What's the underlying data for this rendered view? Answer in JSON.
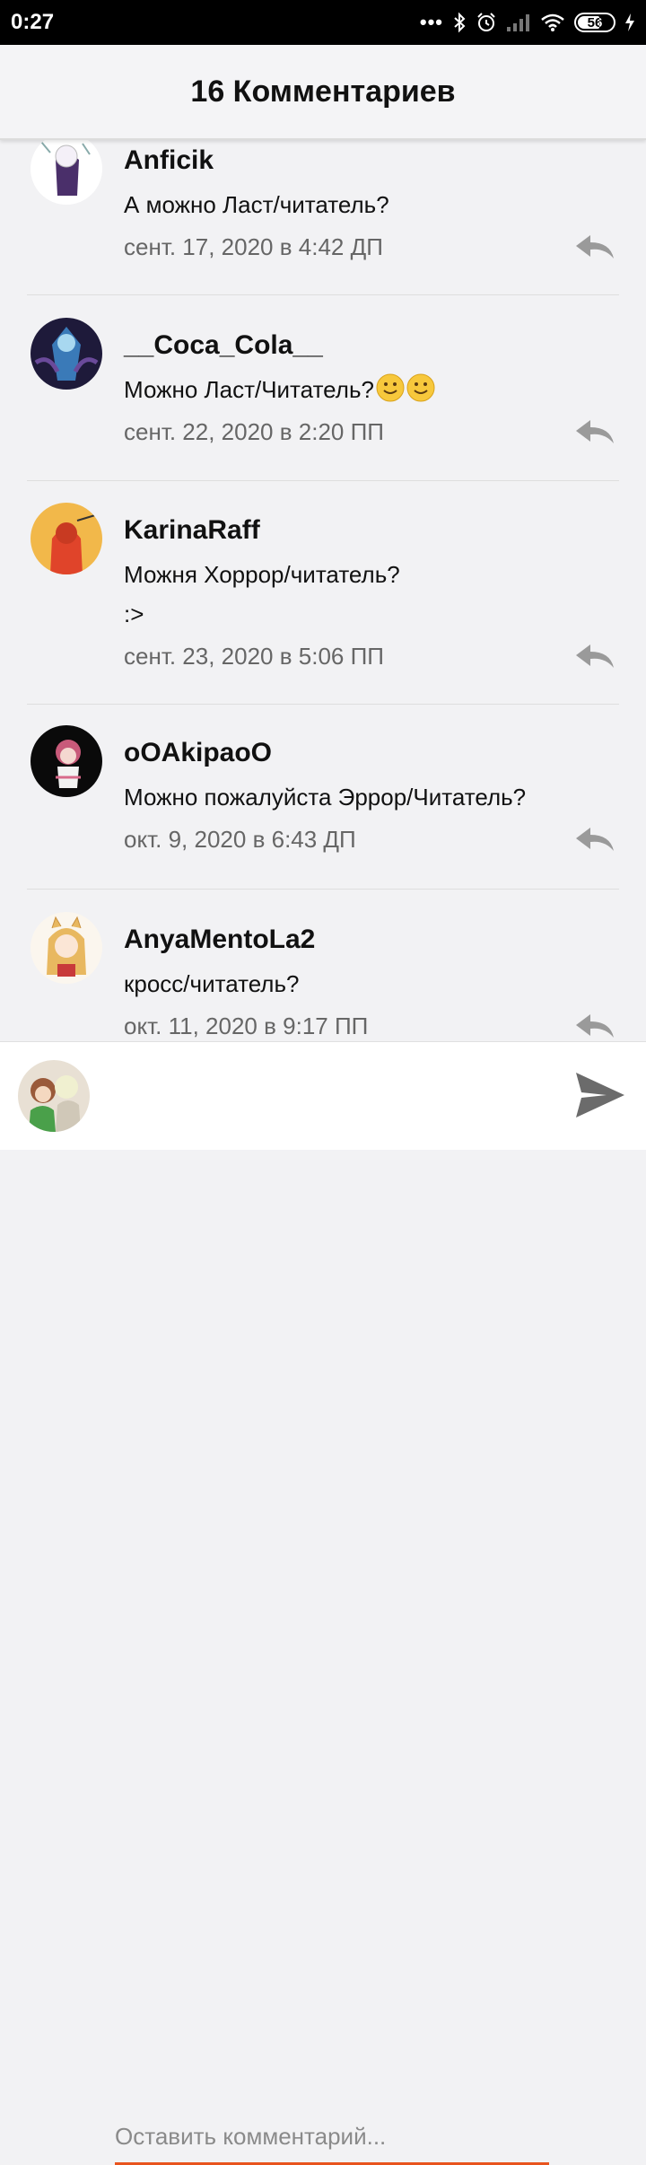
{
  "status_bar": {
    "time": "0:27",
    "dots": "•••",
    "battery": "56"
  },
  "header": {
    "title": "16 Комментариев"
  },
  "comments": [
    {
      "author": "Anficik",
      "text": "А можно Ласт/читатель?",
      "date": "сент. 17, 2020 в 4:42 ДП",
      "avatar_colors": [
        "#ffffff",
        "#5a3a7a"
      ]
    },
    {
      "author": "__Coca_Cola__",
      "text": "Можно Ласт/Читатель?",
      "emoji": "slightly-smiling-face",
      "date": "сент. 22, 2020 в 2:20 ПП",
      "avatar_colors": [
        "#1e1a3a",
        "#3a7ab8"
      ]
    },
    {
      "author": "KarinaRaff",
      "text": "Можня Хоррор/читатель?\n:>",
      "date": "сент. 23, 2020 в 5:06 ПП",
      "avatar_colors": [
        "#f2b84a",
        "#e0442a"
      ]
    },
    {
      "author": "oOAkipaoO",
      "text": "Можно пожалуйста Эррор/Читатель?",
      "date": "окт. 9, 2020 в 6:43 ДП",
      "avatar_colors": [
        "#0a0a0a",
        "#d86a8a"
      ]
    },
    {
      "author": "AnyaMentoLa2",
      "text": "кросс/читатель?",
      "date": "окт. 11, 2020 в 9:17 ПП",
      "avatar_colors": [
        "#fbf6ee",
        "#e8b860"
      ]
    }
  ],
  "composer": {
    "placeholder": "Оставить комментарий...",
    "accent": "#e8541e"
  },
  "colors": {
    "background": "#f2f2f4",
    "accent": "#e8541e",
    "reply_icon": "#9a9a9a",
    "send_icon": "#6b6b6b"
  }
}
